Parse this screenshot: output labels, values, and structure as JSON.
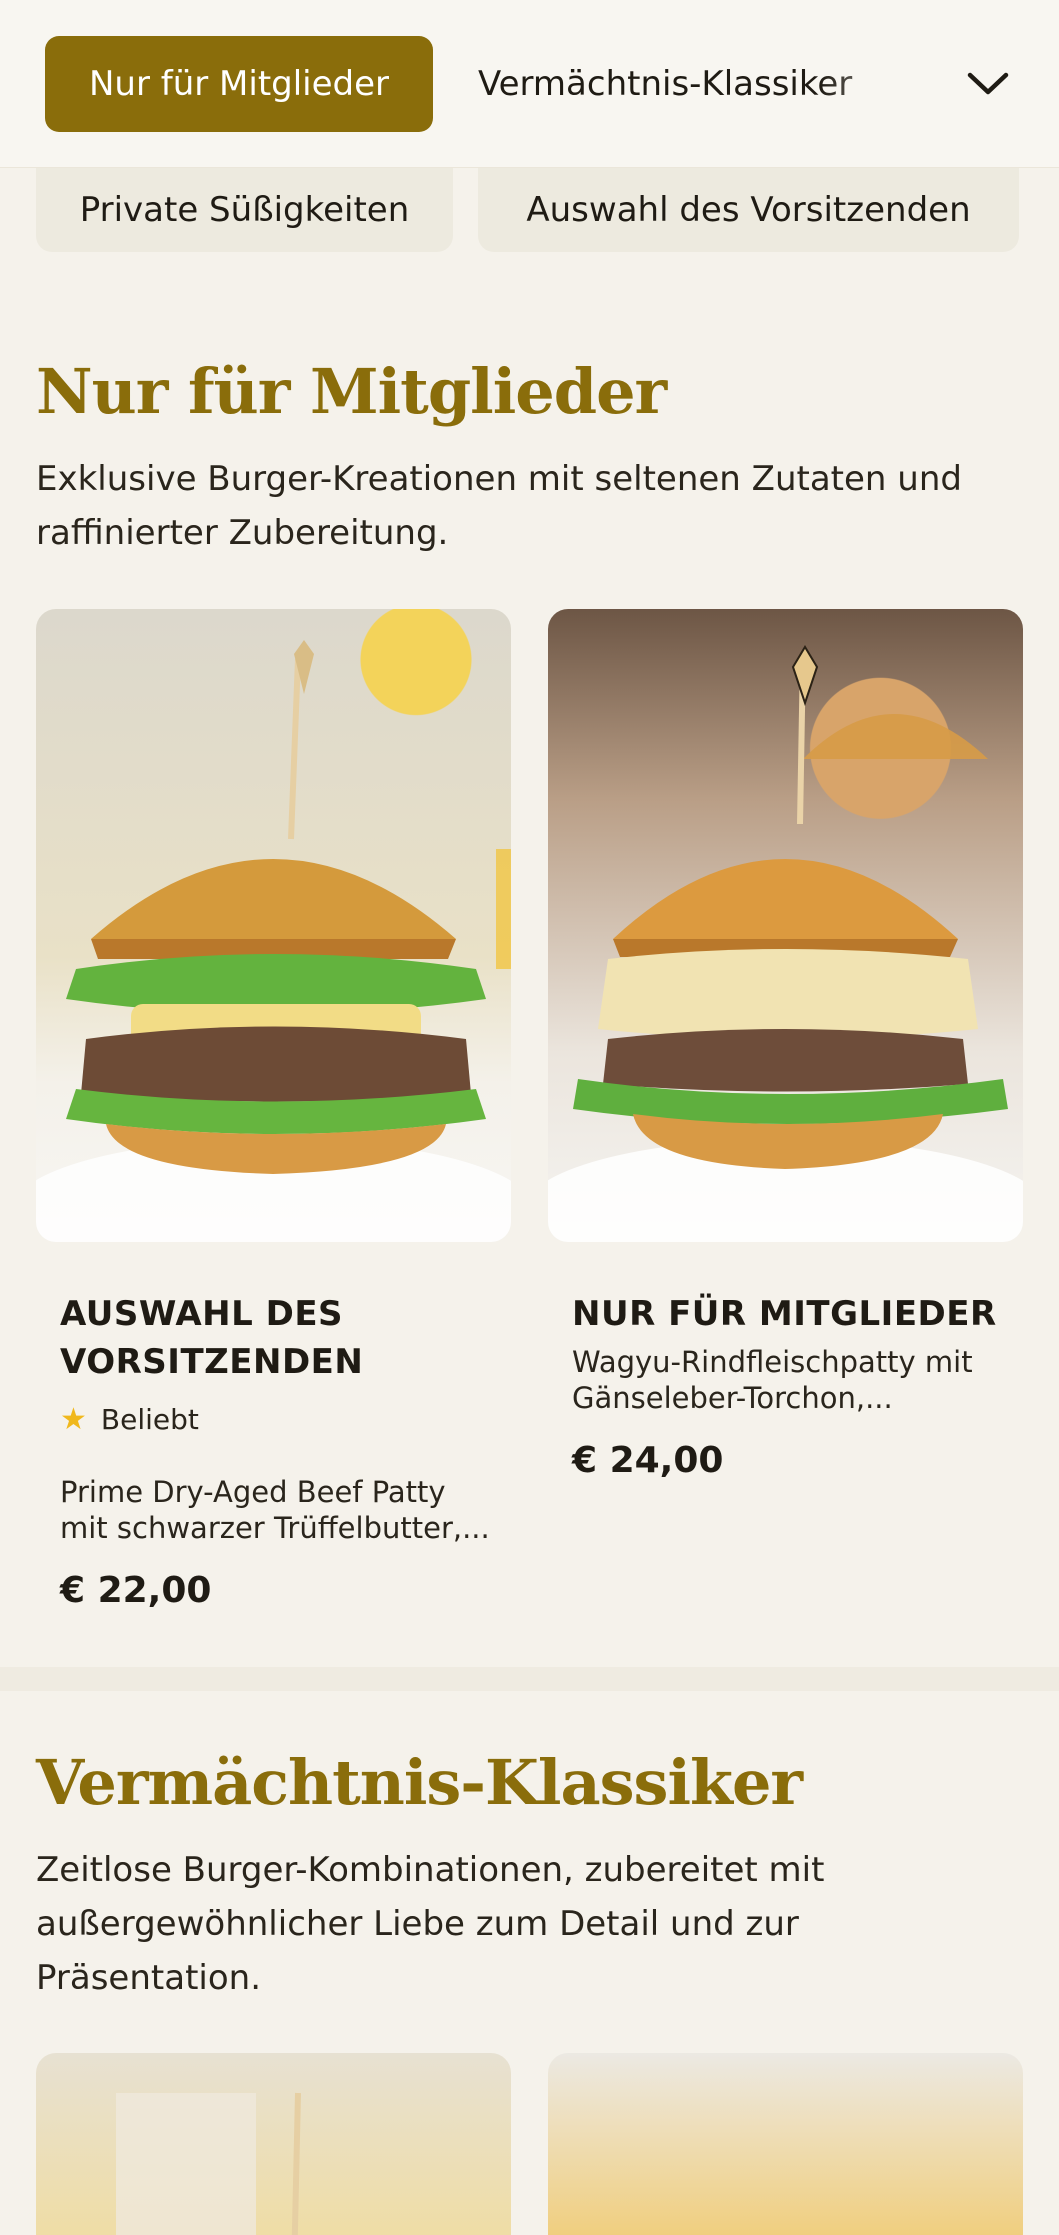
{
  "nav": {
    "active_tab": "Nur für Mitglieder",
    "next_tab": "Vermächtnis-Klassiker",
    "sub_tabs": [
      "Private Süßigkeiten",
      "Auswahl des Vorsitzenden"
    ],
    "expand_icon": "chevron-down-icon"
  },
  "sections": [
    {
      "title": "Nur für Mitglieder",
      "description": "Exklusive Burger-Kreationen mit seltenen Zutaten und raffinierter Zubereitung.",
      "items": [
        {
          "name": "AUSWAHL DES VORSITZENDEN",
          "badge": "Beliebt",
          "badge_icon": "star-icon",
          "description": "Prime Dry-Aged Beef Patty mit schwarzer Trüffelbutter,...",
          "price": "€ 22,00"
        },
        {
          "name": "NUR FÜR MITGLIEDER",
          "description": "Wagyu-Rindfleischpatty mit Gänseleber-Torchon,...",
          "price": "€ 24,00"
        }
      ]
    },
    {
      "title": "Vermächtnis-Klassiker",
      "description": "Zeitlose Burger-Kombinationen, zubereitet mit außergewöhnlicher Liebe zum Detail und zur Präsentation."
    }
  ],
  "colors": {
    "accent": "#8a6d0b",
    "background": "#f5f2eb",
    "star": "#f0b81c"
  }
}
